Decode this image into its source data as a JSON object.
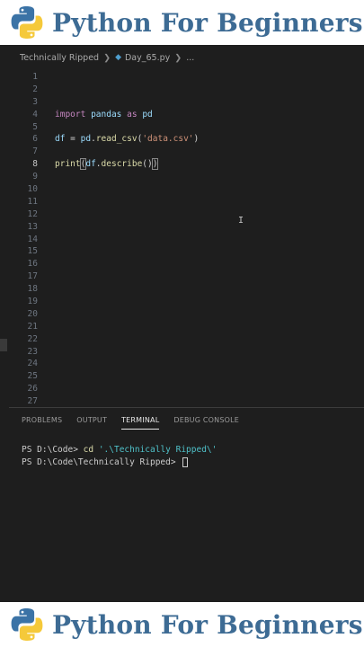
{
  "banner": {
    "title": "Python For Beginners",
    "logo_icon": "python-logo-icon",
    "logo_colors": {
      "blue": "#3b73a6",
      "yellow": "#f5c93a"
    },
    "title_color": "#3d6b94"
  },
  "editor": {
    "breadcrumb": {
      "folder": "Technically Ripped",
      "file": "Day_65.py",
      "more": "..."
    },
    "active_line": 8,
    "line_numbers": [
      "1",
      "2",
      "3",
      "4",
      "5",
      "6",
      "7",
      "8",
      "9",
      "10",
      "11",
      "12",
      "13",
      "14",
      "15",
      "16",
      "17",
      "18",
      "19",
      "20",
      "21",
      "22",
      "23",
      "24",
      "25",
      "26",
      "27"
    ],
    "code": {
      "line4": {
        "kw_import": "import",
        "mod": "pandas",
        "kw_as": "as",
        "alias": "pd"
      },
      "line6": {
        "var": "df",
        "eq": " = ",
        "obj": "pd",
        "dot": ".",
        "fn": "read_csv",
        "open": "(",
        "str": "'data.csv'",
        "close": ")"
      },
      "line8": {
        "fn": "print",
        "open": "(",
        "var": "df",
        "dot": ".",
        "fn2": "describe",
        "parens": "()",
        "close": ")"
      }
    }
  },
  "panel": {
    "tabs": [
      "PROBLEMS",
      "OUTPUT",
      "TERMINAL",
      "DEBUG CONSOLE"
    ],
    "active_tab": "TERMINAL",
    "terminal": {
      "line1_prompt": "PS D:\\Code> ",
      "line1_cmd": "cd",
      "line1_arg": "'.\\Technically Ripped\\'",
      "line2_prompt": "PS D:\\Code\\Technically Ripped> "
    }
  }
}
